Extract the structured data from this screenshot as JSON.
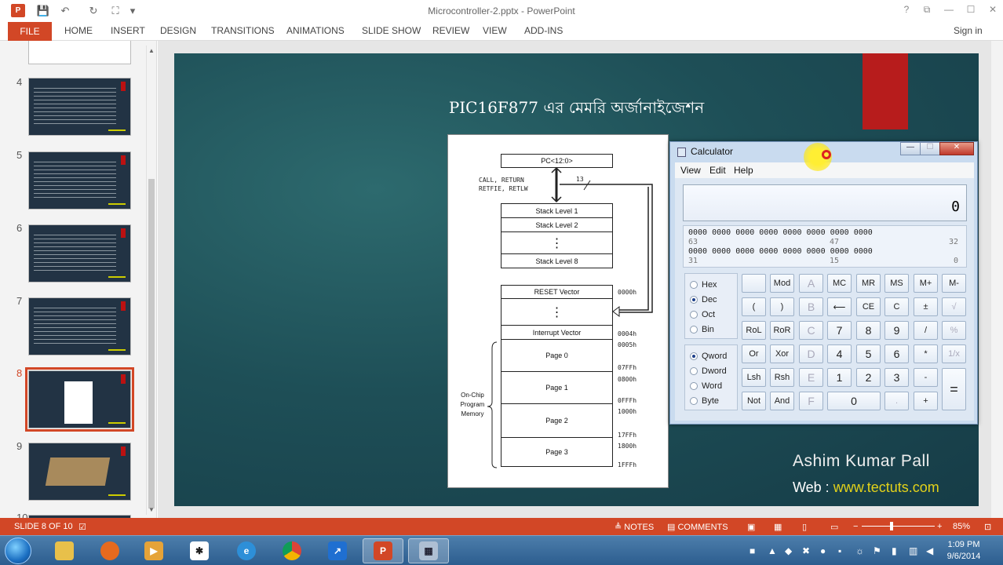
{
  "window": {
    "title": "Microcontroller-2.pptx - PowerPoint",
    "help": "?",
    "restore": "⧉",
    "minimize": "—",
    "maximize": "☐",
    "close": "✕"
  },
  "qat": {
    "save": "💾",
    "undo": "↶",
    "redo": "↻",
    "start": "⛶",
    "more": "▾"
  },
  "ribbon": {
    "file": "FILE",
    "tabs": [
      "HOME",
      "INSERT",
      "DESIGN",
      "TRANSITIONS",
      "ANIMATIONS",
      "SLIDE SHOW",
      "REVIEW",
      "VIEW",
      "ADD-INS"
    ],
    "signin": "Sign in"
  },
  "thumbnails": {
    "numbers": [
      "4",
      "5",
      "6",
      "7",
      "8",
      "9",
      "10"
    ],
    "selected": "8"
  },
  "slide": {
    "title": "PIC16F877 এর মেমরি অর্জানাইজেশন",
    "credit_name": "Ashim Kumar Pall",
    "credit_web_label": "Web : ",
    "credit_web_url": "www.tectuts.com"
  },
  "diagram": {
    "pc": "PC<12:0>",
    "call_return": "CALL, RETURN",
    "retfie": "RETFIE, RETLW",
    "bits": "13",
    "stack1": "Stack Level 1",
    "stack2": "Stack Level 2",
    "dots": "⋮",
    "stack8": "Stack Level 8",
    "reset": "RESET Vector",
    "interrupt": "Interrupt Vector",
    "page0": "Page 0",
    "page1": "Page 1",
    "page2": "Page 2",
    "page3": "Page 3",
    "onchip": "On-Chip",
    "program": "Program",
    "memory": "Memory",
    "addrs": [
      "0000h",
      "0004h",
      "0005h",
      "07FFh",
      "0800h",
      "0FFFh",
      "1000h",
      "17FFh",
      "1800h",
      "1FFFh"
    ]
  },
  "calculator": {
    "title": "Calculator",
    "menu": [
      "View",
      "Edit",
      "Help"
    ],
    "display": "0",
    "bitrow1": "0000   0000   0000   0000   0000   0000   0000   0000",
    "bitrow2": "0000   0000   0000   0000   0000   0000   0000   0000",
    "idx": [
      "63",
      "47",
      "32",
      "31",
      "15",
      "0"
    ],
    "base": [
      "Hex",
      "Dec",
      "Oct",
      "Bin"
    ],
    "base_selected": "Dec",
    "size": [
      "Qword",
      "Dword",
      "Word",
      "Byte"
    ],
    "size_selected": "Qword",
    "keys": {
      "r1": [
        "",
        "Mod",
        "A",
        "MC",
        "MR",
        "MS",
        "M+",
        "M-"
      ],
      "r2": [
        "(",
        ")",
        "B",
        "⟵",
        "CE",
        "C",
        "±",
        "√"
      ],
      "r3": [
        "RoL",
        "RoR",
        "C",
        "7",
        "8",
        "9",
        "/",
        "%"
      ],
      "r4": [
        "Or",
        "Xor",
        "D",
        "4",
        "5",
        "6",
        "*",
        "1/x"
      ],
      "r5": [
        "Lsh",
        "Rsh",
        "E",
        "1",
        "2",
        "3",
        "-",
        "="
      ],
      "r6": [
        "Not",
        "And",
        "F",
        "0",
        ".",
        "+"
      ]
    }
  },
  "statusbar": {
    "slide": "SLIDE 8 OF 10",
    "notes": "≜ NOTES",
    "comments": "▤ COMMENTS",
    "zoom": "85%",
    "minus": "−",
    "plus": "+"
  },
  "taskbar": {
    "time": "1:09 PM",
    "date": "9/6/2014"
  },
  "colors": {
    "accent": "#D24726",
    "slide_bg": "#1E4F57",
    "credit_url": "#E3D21A"
  }
}
